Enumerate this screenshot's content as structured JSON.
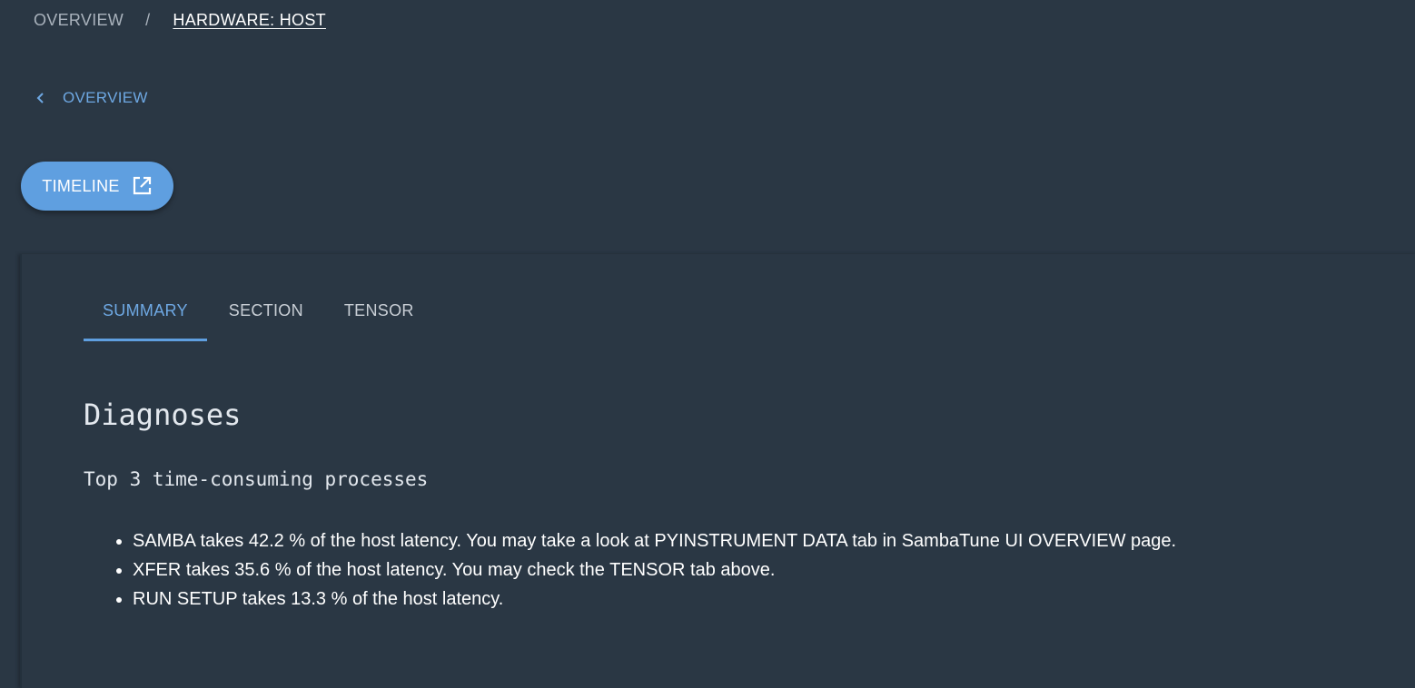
{
  "breadcrumb": {
    "root": "OVERVIEW",
    "separator": "/",
    "current": "HARDWARE: HOST"
  },
  "back_link": {
    "label": "OVERVIEW",
    "icon": "chevron-left-icon"
  },
  "timeline_button": {
    "label": "TIMELINE",
    "icon": "open-in-new-icon"
  },
  "tabs": [
    {
      "label": "SUMMARY",
      "active": true
    },
    {
      "label": "SECTION",
      "active": false
    },
    {
      "label": "TENSOR",
      "active": false
    }
  ],
  "summary": {
    "heading": "Diagnoses",
    "subheading": "Top 3 time-consuming processes",
    "items": [
      "SAMBA takes 42.2 % of the host latency. You may take a look at PYINSTRUMENT DATA tab in SambaTune UI OVERVIEW page.",
      "XFER takes 35.6 % of the host latency. You may check the TENSOR tab above.",
      "RUN SETUP takes 13.3 % of the host latency."
    ]
  },
  "colors": {
    "background": "#2a3744",
    "accent": "#5f9fe0",
    "accent_text": "#6ea8e3"
  }
}
